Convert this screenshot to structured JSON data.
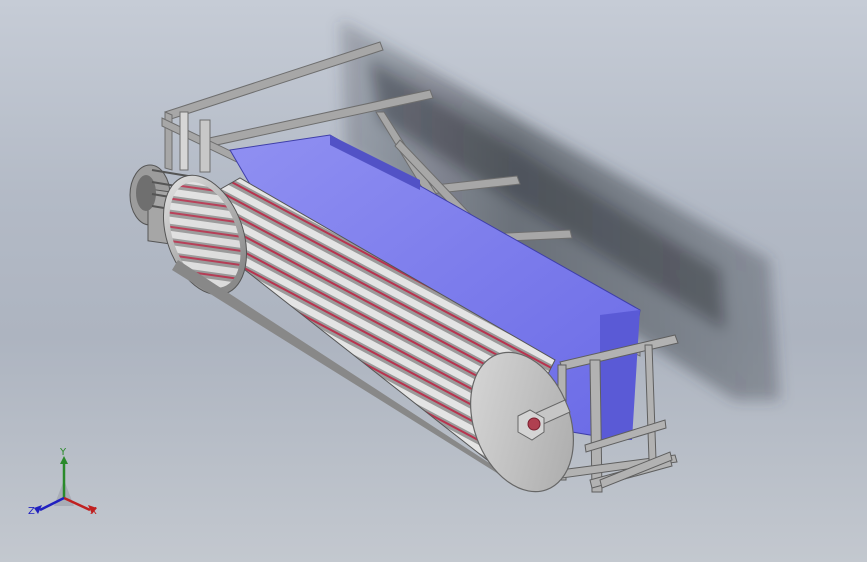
{
  "viewport": {
    "background_top": "#c6ccd6",
    "background_bottom": "#c3c8cf"
  },
  "model": {
    "drum_color": "#d8d8d8",
    "panel_color": "#7f7ff0",
    "frame_color": "#9a9a9a",
    "highlight_color": "#c0304a"
  },
  "triad": {
    "x_label": "X",
    "y_label": "Y",
    "z_label": "Z",
    "x_color": "#c02020",
    "y_color": "#2a8a2a",
    "z_color": "#2020c0"
  }
}
